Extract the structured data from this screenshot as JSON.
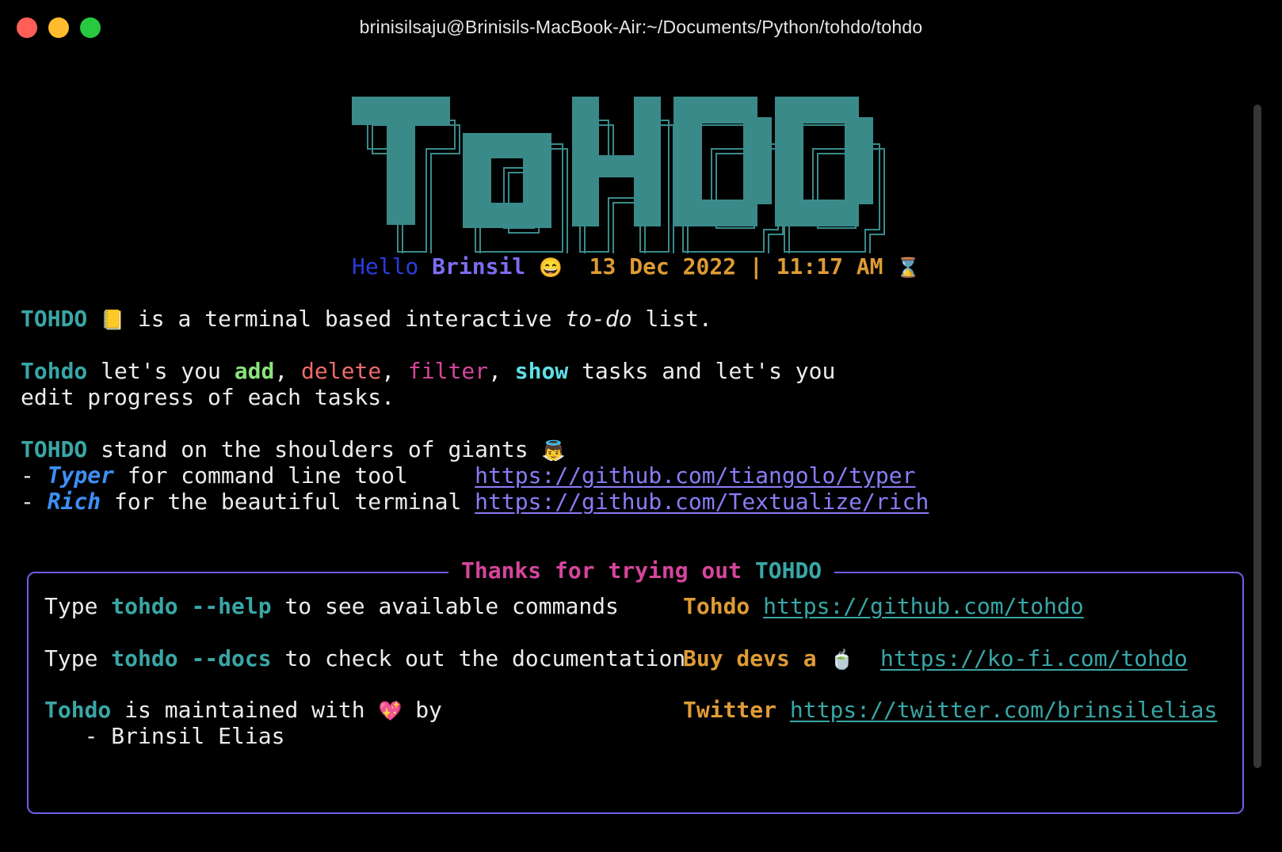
{
  "window": {
    "title": "brinisilsaju@Brinisils-MacBook-Air:~/Documents/Python/tohdo/tohdo"
  },
  "banner": {
    "art_text": "TOHDO",
    "color": "#3a8a8a"
  },
  "greeting": {
    "hello": "Hello",
    "name": "Brinsil",
    "emoji": "😄",
    "datetime": "13 Dec 2022 | 11:17 AM",
    "hourglass": "⌛"
  },
  "intro": {
    "brand": "TOHDO",
    "notebook": "📒",
    "text_before": " is a terminal based interactive ",
    "text_italic": "to-do",
    "text_after": " list."
  },
  "features": {
    "brand": "Tohdo",
    "lets_you": " let's you ",
    "add": "add",
    "sep1": ", ",
    "delete": "delete",
    "sep2": ", ",
    "filter": "filter",
    "sep3": ", ",
    "show": "show",
    "tail": " tasks and let's you",
    "line2": "edit progress of each tasks."
  },
  "giants": {
    "brand": "TOHDO",
    "text": " stand on the shoulders of giants ",
    "emoji": "👼",
    "items": [
      {
        "dash": "- ",
        "name": "Typer",
        "desc": " for command line tool     ",
        "url": "https://github.com/tiangolo/typer"
      },
      {
        "dash": "- ",
        "name": "Rich",
        "desc": " for the beautiful terminal ",
        "url": "https://github.com/Textualize/rich"
      }
    ]
  },
  "panel": {
    "title_prefix": "Thanks for trying out ",
    "title_brand": "TOHDO",
    "help": {
      "pre": "Type ",
      "cmd": "tohdo --help",
      "post": " to see available commands"
    },
    "docs": {
      "pre": "Type ",
      "cmd": "tohdo --docs",
      "post": " to check out the documentation"
    },
    "maintained": {
      "brand": "Tohdo",
      "text": " is maintained with ",
      "heart": "💖",
      "by": " by",
      "author": "   - Brinsil Elias"
    },
    "links": [
      {
        "label": "Tohdo",
        "url": "https://github.com/tohdo"
      },
      {
        "label": "Buy devs a",
        "emoji": "🍵",
        "url": "https://ko-fi.com/tohdo"
      },
      {
        "label": "Twitter",
        "url": "https://twitter.com/brinsilelias"
      }
    ]
  }
}
